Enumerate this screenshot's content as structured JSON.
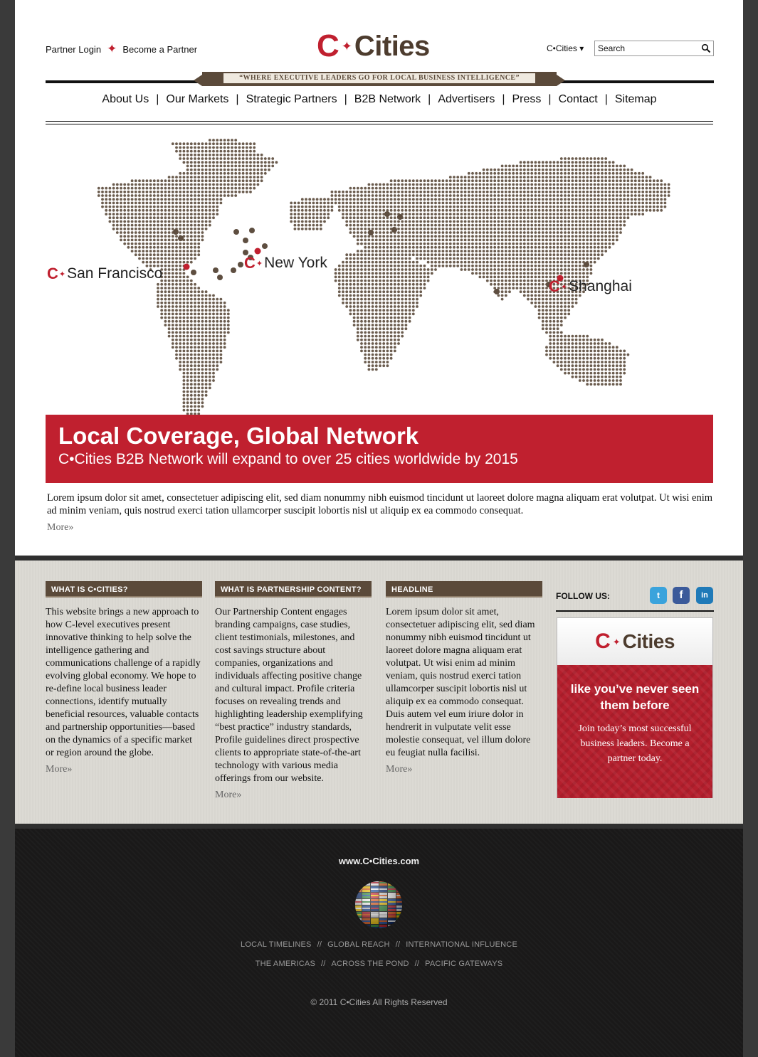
{
  "header": {
    "partner_login": "Partner Login",
    "become_partner": "Become a Partner",
    "logo_c": "C",
    "logo_text": "Cities",
    "city_select": "C•Cities ▾",
    "search_placeholder": "Search",
    "tagline": "“WHERE EXECUTIVE LEADERS GO FOR LOCAL BUSINESS INTELLIGENCE”"
  },
  "nav": [
    "About Us",
    "Our Markets",
    "Strategic Partners",
    "B2B Network",
    "Advertisers",
    "Press",
    "Contact",
    "Sitemap"
  ],
  "map": {
    "cities": [
      "San Francisco",
      "New York",
      "Shanghai"
    ],
    "dot_color": "#6b5c4e",
    "marker_color": "#c0202f"
  },
  "banner": {
    "title": "Local Coverage, Global Network",
    "subtitle": "C•Cities B2B Network will expand to over 25 cities worldwide by 2015"
  },
  "intro": {
    "text": "Lorem ipsum dolor sit amet, consectetuer adipiscing elit, sed diam nonummy nibh euismod tincidunt ut laoreet dolore magna aliquam erat volutpat. Ut wisi enim ad minim veniam, quis nostrud exerci tation ullamcorper suscipit lobortis nisl ut aliquip ex ea commodo consequat.",
    "more": "More»"
  },
  "columns": [
    {
      "heading": "WHAT IS C•CITIES?",
      "body": "This website brings a new approach to how C-level executives present innovative thinking to help solve the intelligence gathering and communications challenge of a rapidly evolving global economy. We hope to re-define local business leader connections, identify mutually beneficial resources, valuable contacts and partnership opportunities—based on the dynamics of a specific market or region around the globe.",
      "more": "More»"
    },
    {
      "heading": "WHAT IS PARTNERSHIP CONTENT?",
      "body": "Our Partnership Content engages branding campaigns, case studies, client testimonials, milestones, and cost savings structure about companies, organizations and individuals affecting positive change and cultural impact. Profile criteria focuses on revealing trends and highlighting leadership exemplifying “best practice” industry standards, Profile guidelines direct prospective clients to appropriate state-of-the-art technology with various media offerings from our website.",
      "more": "More»"
    },
    {
      "heading": "HEADLINE",
      "body": "Lorem ipsum dolor sit amet, consectetuer adipiscing elit, sed diam nonummy nibh euismod tincidunt ut laoreet dolore magna aliquam erat volutpat. Ut wisi enim ad minim veniam, quis nostrud exerci tation ullamcorper suscipit lobortis nisl ut aliquip ex ea commodo consequat. Duis autem vel eum iriure dolor in hendrerit in vulputate velit esse molestie consequat, vel illum dolore eu feugiat nulla facilisi.",
      "more": "More»"
    }
  ],
  "follow": {
    "label": "FOLLOW US:",
    "twitter": "t",
    "facebook": "f",
    "linkedin": "in"
  },
  "ad": {
    "logo_c": "C",
    "logo_text": "Cities",
    "headline": "like you’ve never seen them before",
    "sub": "Join today’s most successful business leaders. Become a partner today."
  },
  "footer": {
    "url": "www.C•Cities.com",
    "line1": [
      "LOCAL TIMELINES",
      "GLOBAL REACH",
      "INTERNATIONAL INFLUENCE"
    ],
    "line2": [
      "THE AMERICAS",
      "ACROSS THE POND",
      "PACIFIC GATEWAYS"
    ],
    "separator": "//",
    "copyright": "© 2011 C•Cities All Rights Reserved"
  }
}
